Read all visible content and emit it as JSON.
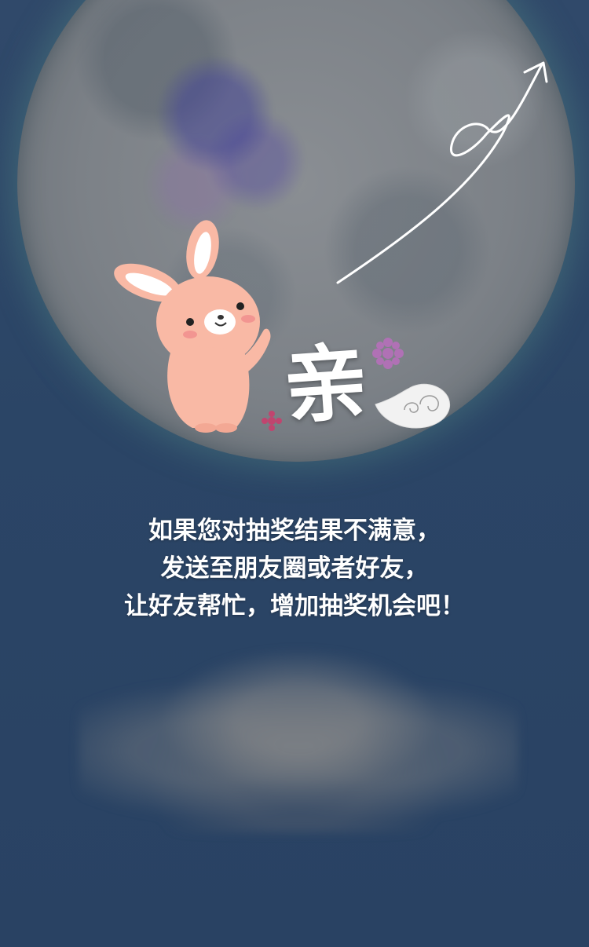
{
  "decor": {
    "headline_char": "亲"
  },
  "message": {
    "line1": "如果您对抽奖结果不满意，",
    "line2": "发送至朋友圈或者好友，",
    "line3": "让好友帮忙，增加抽奖机会吧！"
  },
  "colors": {
    "background": "#2b4464",
    "moon": "#7c8187",
    "bunny_body": "#f9b9a5",
    "bunny_ear_inner": "#ffffff",
    "flower": "#b071b5",
    "text": "#ffffff"
  },
  "icons": {
    "moon": "full-moon",
    "bunny": "rabbit-mascot",
    "arrow": "curly-arrow-up-right",
    "cloud": "auspicious-cloud",
    "flower": "flower-sparkle"
  }
}
